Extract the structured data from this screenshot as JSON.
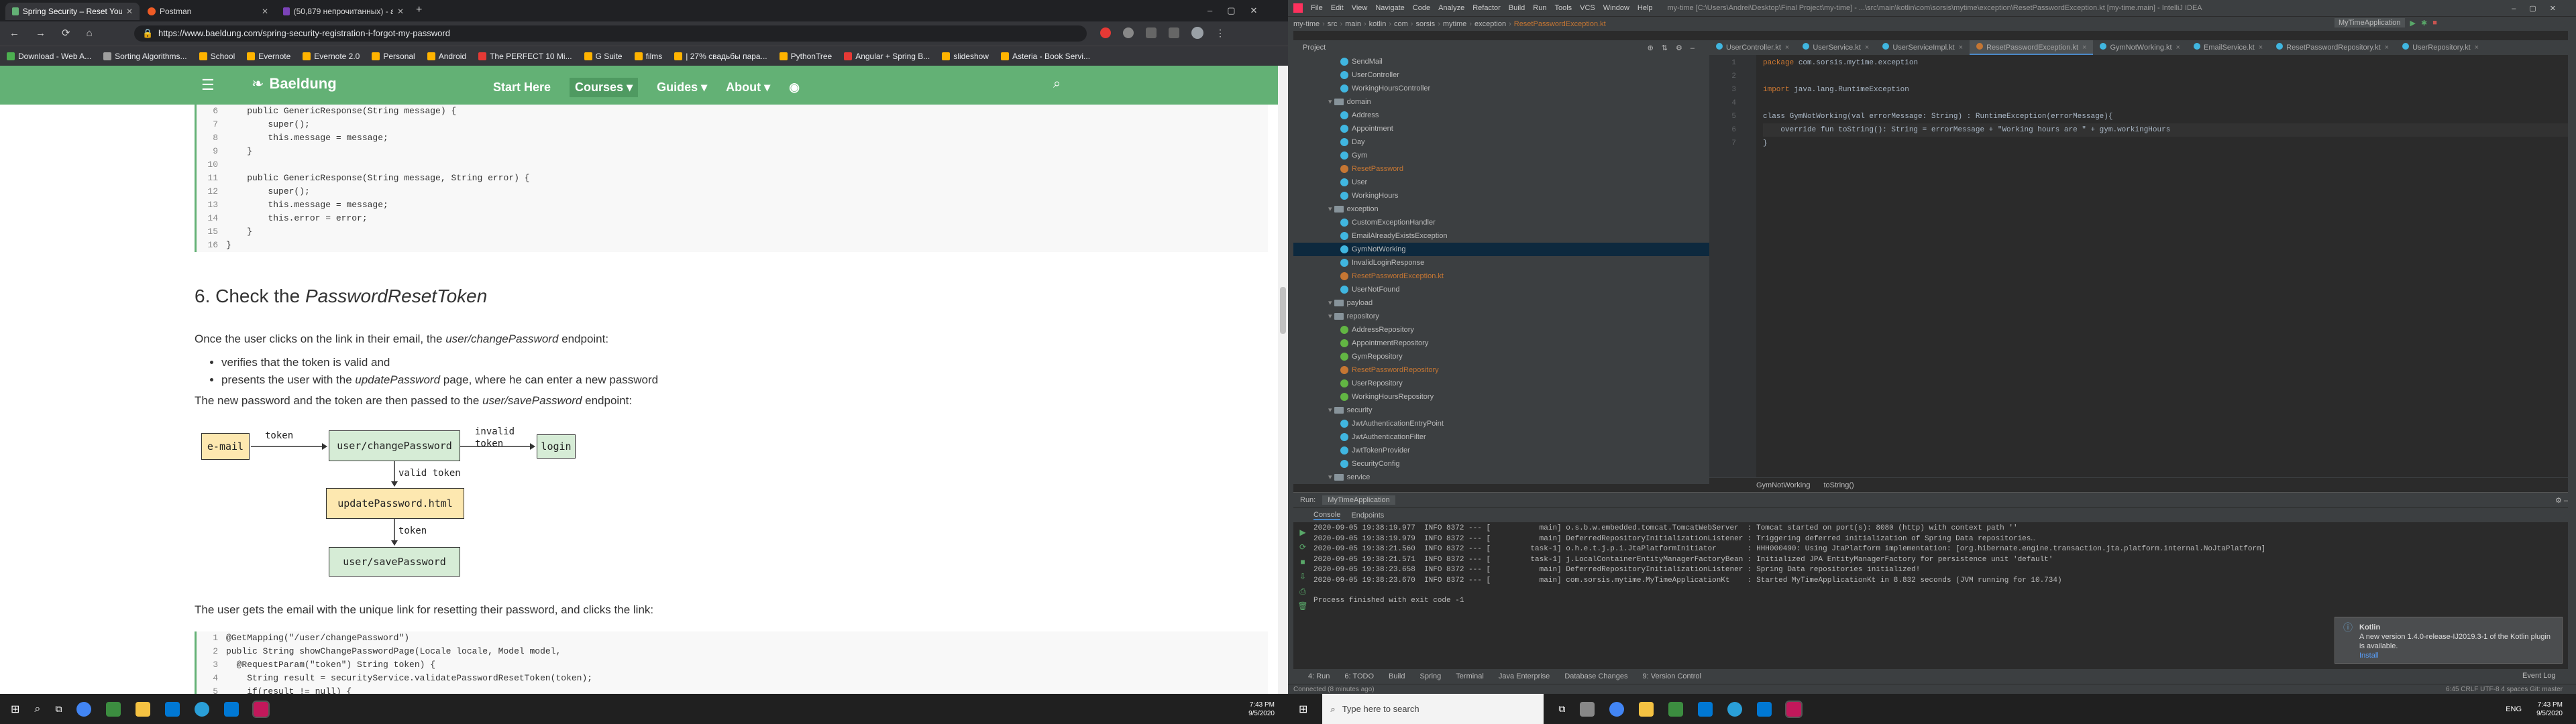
{
  "browser": {
    "tabs": [
      {
        "title": "Spring Security – Reset Your Pa..."
      },
      {
        "title": "Postman"
      },
      {
        "title": "(50,879 непрочитанных) - andre..."
      }
    ],
    "new_tab": "+",
    "url": "https://www.baeldung.com/spring-security-registration-i-forgot-my-password",
    "bookmarks": [
      "Download - Web A...",
      "Sorting Algorithms...",
      "School",
      "Evernote",
      "Evernote 2.0",
      "Personal",
      "Android",
      "The PERFECT 10 Mi...",
      "G Suite",
      "films",
      "| 27% свадьбы пара...",
      "PythonTree",
      "Angular + Spring B...",
      "slideshow",
      "Asteria - Book Servi..."
    ]
  },
  "site": {
    "logo": "Baeldung",
    "nav": [
      "Start Here",
      "Courses ▾",
      "Guides ▾",
      "About ▾"
    ],
    "code1": [
      {
        "n": "6",
        "t": "    public GenericResponse(String message) {"
      },
      {
        "n": "7",
        "t": "        super();"
      },
      {
        "n": "8",
        "t": "        this.message = message;"
      },
      {
        "n": "9",
        "t": "    }"
      },
      {
        "n": "10",
        "t": ""
      },
      {
        "n": "11",
        "t": "    public GenericResponse(String message, String error) {"
      },
      {
        "n": "12",
        "t": "        super();"
      },
      {
        "n": "13",
        "t": "        this.message = message;"
      },
      {
        "n": "14",
        "t": "        this.error = error;"
      },
      {
        "n": "15",
        "t": "    }"
      },
      {
        "n": "16",
        "t": "}"
      }
    ],
    "heading_prefix": "6. Check the ",
    "heading_em": "PasswordResetToken",
    "p1": "Once the user clicks on the link in their email, the ",
    "p1_em": "user/changePassword",
    "p1_end": " endpoint:",
    "bullets": [
      "verifies that the token is valid and",
      "presents the user with the "
    ],
    "bullet2_em": "updatePassword",
    "bullet2_end": " page, where he can enter a new password",
    "p2": "The new password and the token are then passed to the ",
    "p2_em": "user/savePassword",
    "p2_end": " endpoint:",
    "diagram": {
      "email": "e-mail",
      "token1": "token",
      "change": "user/changePassword",
      "invalid": "invalid",
      "invalid_token": "token",
      "login": "login",
      "valid_token": "valid token",
      "update": "updatePassword.html",
      "token2": "token",
      "save": "user/savePassword"
    },
    "p3": "The user gets the email with the unique link for resetting their password, and clicks the link:",
    "code2": [
      {
        "n": "1",
        "t": "@GetMapping(\"/user/changePassword\")"
      },
      {
        "n": "2",
        "t": "public String showChangePasswordPage(Locale locale, Model model,"
      },
      {
        "n": "3",
        "t": "  @RequestParam(\"token\") String token) {"
      },
      {
        "n": "4",
        "t": "    String result = securityService.validatePasswordResetToken(token);"
      },
      {
        "n": "5",
        "t": "    if(result != null) {"
      }
    ]
  },
  "ide": {
    "menu": [
      "File",
      "Edit",
      "View",
      "Navigate",
      "Code",
      "Analyze",
      "Refactor",
      "Build",
      "Run",
      "Tools",
      "VCS",
      "Window",
      "Help",
      "my-time [C:\\Users\\Andrei\\Desktop\\Final Project\\my-time] - ...\\src\\main\\kotlin\\com\\sorsis\\mytime\\exception\\ResetPasswordException.kt [my-time.main] - IntelliJ IDEA"
    ],
    "path": [
      "my-time",
      "src",
      "main",
      "kotlin",
      "com",
      "sorsis",
      "mytime",
      "exception",
      "ResetPasswordException.kt"
    ],
    "run_config": "MyTimeApplication",
    "project_label": "Project",
    "tree": [
      {
        "t": "SendMail",
        "d": 3,
        "k": "c",
        "c": "#40b6e0"
      },
      {
        "t": "UserController",
        "d": 3,
        "k": "c",
        "c": "#40b6e0"
      },
      {
        "t": "WorkingHoursController",
        "d": 3,
        "k": "c",
        "c": "#40b6e0"
      },
      {
        "t": "domain",
        "d": 2,
        "k": "f",
        "c": "#87939a"
      },
      {
        "t": "Address",
        "d": 3,
        "k": "c",
        "c": "#40b6e0"
      },
      {
        "t": "Appointment",
        "d": 3,
        "k": "c",
        "c": "#40b6e0"
      },
      {
        "t": "Day",
        "d": 3,
        "k": "c",
        "c": "#40b6e0"
      },
      {
        "t": "Gym",
        "d": 3,
        "k": "c",
        "c": "#40b6e0"
      },
      {
        "t": "ResetPassword",
        "d": 3,
        "k": "c",
        "c": "#c57633"
      },
      {
        "t": "User",
        "d": 3,
        "k": "c",
        "c": "#40b6e0"
      },
      {
        "t": "WorkingHours",
        "d": 3,
        "k": "c",
        "c": "#40b6e0"
      },
      {
        "t": "exception",
        "d": 2,
        "k": "f",
        "c": "#87939a"
      },
      {
        "t": "CustomExceptionHandler",
        "d": 3,
        "k": "c",
        "c": "#40b6e0"
      },
      {
        "t": "EmailAlreadyExistsException",
        "d": 3,
        "k": "c",
        "c": "#40b6e0"
      },
      {
        "t": "GymNotWorking",
        "d": 3,
        "k": "c",
        "c": "#40b6e0",
        "sel": true
      },
      {
        "t": "InvalidLoginResponse",
        "d": 3,
        "k": "c",
        "c": "#40b6e0"
      },
      {
        "t": "ResetPasswordException.kt",
        "d": 3,
        "k": "c",
        "c": "#c57633"
      },
      {
        "t": "UserNotFound",
        "d": 3,
        "k": "c",
        "c": "#40b6e0"
      },
      {
        "t": "payload",
        "d": 2,
        "k": "f",
        "c": "#87939a"
      },
      {
        "t": "repository",
        "d": 2,
        "k": "f",
        "c": "#87939a"
      },
      {
        "t": "AddressRepository",
        "d": 3,
        "k": "c",
        "c": "#62b543"
      },
      {
        "t": "AppointmentRepository",
        "d": 3,
        "k": "c",
        "c": "#62b543"
      },
      {
        "t": "GymRepository",
        "d": 3,
        "k": "c",
        "c": "#62b543"
      },
      {
        "t": "ResetPasswordRepository",
        "d": 3,
        "k": "c",
        "c": "#c57633"
      },
      {
        "t": "UserRepository",
        "d": 3,
        "k": "c",
        "c": "#62b543"
      },
      {
        "t": "WorkingHoursRepository",
        "d": 3,
        "k": "c",
        "c": "#62b543"
      },
      {
        "t": "security",
        "d": 2,
        "k": "f",
        "c": "#87939a"
      },
      {
        "t": "JwtAuthenticationEntryPoint",
        "d": 3,
        "k": "c",
        "c": "#40b6e0"
      },
      {
        "t": "JwtAuthenticationFilter",
        "d": 3,
        "k": "c",
        "c": "#40b6e0"
      },
      {
        "t": "JwtTokenProvider",
        "d": 3,
        "k": "c",
        "c": "#40b6e0"
      },
      {
        "t": "SecurityConfig",
        "d": 3,
        "k": "c",
        "c": "#40b6e0"
      },
      {
        "t": "service",
        "d": 2,
        "k": "f",
        "c": "#87939a"
      }
    ],
    "editor_tabs": [
      "UserController.kt",
      "UserService.kt",
      "UserServiceImpl.kt",
      "ResetPasswordException.kt",
      "GymNotWorking.kt",
      "EmailService.kt",
      "ResetPasswordRepository.kt",
      "UserRepository.kt"
    ],
    "active_tab": 3,
    "code": {
      "l1_kw": "package",
      "l1": " com.sorsis.mytime.exception",
      "l3_kw": "import",
      "l3": " java.lang.RuntimeException",
      "l5": "class GymNotWorking(val errorMessage: String) : RuntimeException(errorMessage){",
      "l6": "    override fun toString(): String = errorMessage + \"Working hours are \" + gym.workingHours",
      "l7": "}"
    },
    "crumb": [
      "GymNotWorking",
      "toString()"
    ],
    "run_title": "Run:",
    "run_app": "MyTimeApplication",
    "run_tabs": [
      "Console",
      "Endpoints"
    ],
    "log": [
      "2020-09-05 19:38:19.977  INFO 8372 --- [           main] o.s.b.w.embedded.tomcat.TomcatWebServer  : Tomcat started on port(s): 8080 (http) with context path ''",
      "2020-09-05 19:38:19.979  INFO 8372 --- [           main] DeferredRepositoryInitializationListener : Triggering deferred initialization of Spring Data repositories…",
      "2020-09-05 19:38:21.560  INFO 8372 --- [         task-1] o.h.e.t.j.p.i.JtaPlatformInitiator       : HHH000490: Using JtaPlatform implementation: [org.hibernate.engine.transaction.jta.platform.internal.NoJtaPlatform]",
      "2020-09-05 19:38:21.571  INFO 8372 --- [         task-1] j.LocalContainerEntityManagerFactoryBean : Initialized JPA EntityManagerFactory for persistence unit 'default'",
      "2020-09-05 19:38:23.658  INFO 8372 --- [           main] DeferredRepositoryInitializationListener : Spring Data repositories initialized!",
      "2020-09-05 19:38:23.670  INFO 8372 --- [           main] com.sorsis.mytime.MyTimeApplicationKt    : Started MyTimeApplicationKt in 8.832 seconds (JVM running for 10.734)",
      "",
      "Process finished with exit code -1"
    ],
    "bottom_tabs": [
      "4: Run",
      "6: TODO",
      "Build",
      "Spring",
      "Terminal",
      "Java Enterprise",
      "Database Changes",
      "9: Version Control"
    ],
    "status": "Connected (8 minutes ago)",
    "status_right": "6:45   CRLF   UTF-8   4 spaces   Git: master",
    "event_log": "Event Log",
    "notification": {
      "title": "Kotlin",
      "body": "A new version 1.4.0-release-IJ2019.3-1 of the Kotlin plugin is available.",
      "link": "Install"
    }
  },
  "taskbar": {
    "left_time": "7:43 PM",
    "left_date": "9/5/2020",
    "search": "Type here to search",
    "right_time": "7:43 PM",
    "right_date": "9/5/2020",
    "lang": "ENG"
  }
}
